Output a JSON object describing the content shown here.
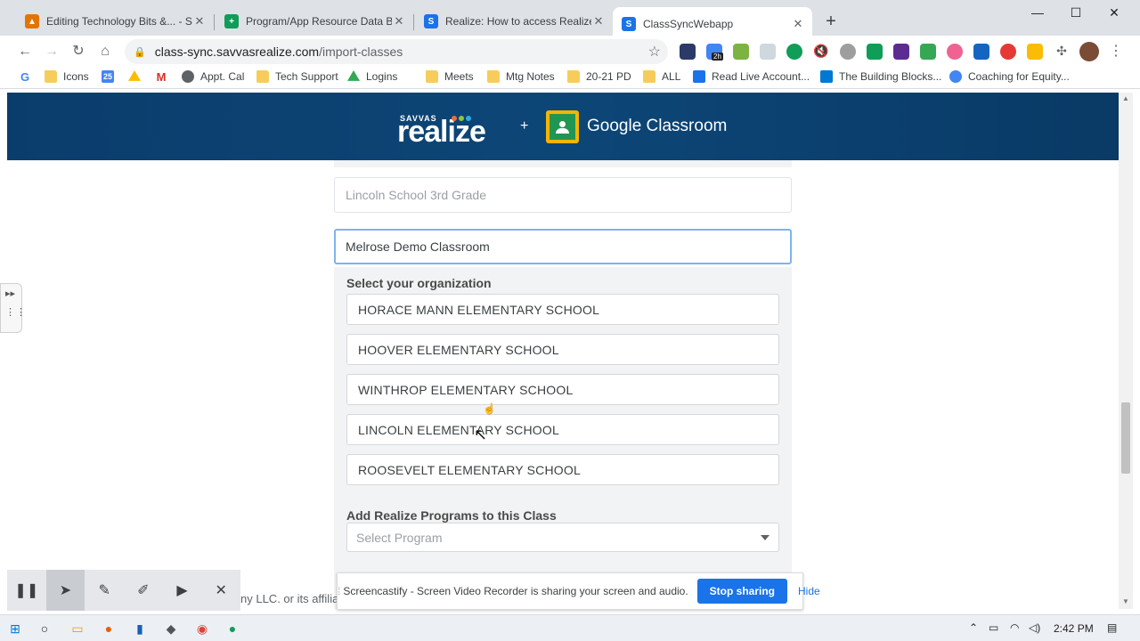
{
  "browser": {
    "tabs": [
      {
        "title": "Editing Technology Bits &... - Sm",
        "favicon_color": "#e37400",
        "active": false
      },
      {
        "title": "Program/App Resource Data Ba",
        "favicon_color": "#0f9d58",
        "active": false
      },
      {
        "title": "Realize: How to access Realize di",
        "favicon_color": "#1a73e8",
        "active": false
      },
      {
        "title": "ClassSyncWebapp",
        "favicon_color": "#1a73e8",
        "active": true
      }
    ],
    "new_tab": "+",
    "window_controls": {
      "minimize": "—",
      "maximize": "☐",
      "close": "✕"
    },
    "url_host": "class-sync.savvasrealize.com",
    "url_path": "/import-classes",
    "extension_badge": "2h",
    "bookmarks": [
      {
        "label": "",
        "icon": "google-icon"
      },
      {
        "label": "Icons",
        "icon": "folder-icon"
      },
      {
        "label": "",
        "icon": "calendar-icon"
      },
      {
        "label": "",
        "icon": "drive-icon"
      },
      {
        "label": "",
        "icon": "gmail-icon"
      },
      {
        "label": "Appt. Cal",
        "icon": "globe-icon"
      },
      {
        "label": "Tech Support",
        "icon": "folder-icon"
      },
      {
        "label": "Logins",
        "icon": "drive-icon"
      },
      {
        "label": "Meets",
        "icon": "folder-icon"
      },
      {
        "label": "Mtg Notes",
        "icon": "folder-icon"
      },
      {
        "label": "20-21 PD",
        "icon": "folder-icon"
      },
      {
        "label": "ALL",
        "icon": "folder-icon"
      },
      {
        "label": "Read Live Account...",
        "icon": "read-live-icon"
      },
      {
        "label": "The Building Blocks...",
        "icon": "windows-icon"
      },
      {
        "label": "Coaching for Equity...",
        "icon": "google-icon"
      }
    ]
  },
  "page": {
    "brand_top": "SAVVAS",
    "brand_main": "realize",
    "plus": "+",
    "partner": "Google Classroom",
    "class_fields": [
      {
        "value": "Lincoln School 3rd Grade",
        "focused": false
      },
      {
        "value": "Melrose Demo Classroom",
        "focused": true
      }
    ],
    "org_label": "Select your organization",
    "organizations": [
      "HORACE MANN ELEMENTARY SCHOOL",
      "HOOVER ELEMENTARY SCHOOL",
      "WINTHROP ELEMENTARY SCHOOL",
      "LINCOLN ELEMENTARY SCHOOL",
      "ROOSEVELT ELEMENTARY SCHOOL"
    ],
    "programs_label": "Add Realize Programs to this Class",
    "program_placeholder": "Select Program",
    "footer_text": "ny LLC. or its affilia"
  },
  "screencastify": {
    "toolbar": [
      "pause-icon",
      "pointer-icon",
      "pen-icon",
      "highlighter-icon",
      "camera-icon",
      "close-icon"
    ],
    "share_message": "Screencastify - Screen Video Recorder is sharing your screen and audio.",
    "stop_label": "Stop sharing",
    "hide_label": "Hide"
  },
  "taskbar": {
    "time": "2:42 PM"
  },
  "colors": {
    "banner": "#0c4677",
    "accent": "#1a73e8",
    "gc_yellow": "#f5b400",
    "gc_green": "#219653"
  }
}
